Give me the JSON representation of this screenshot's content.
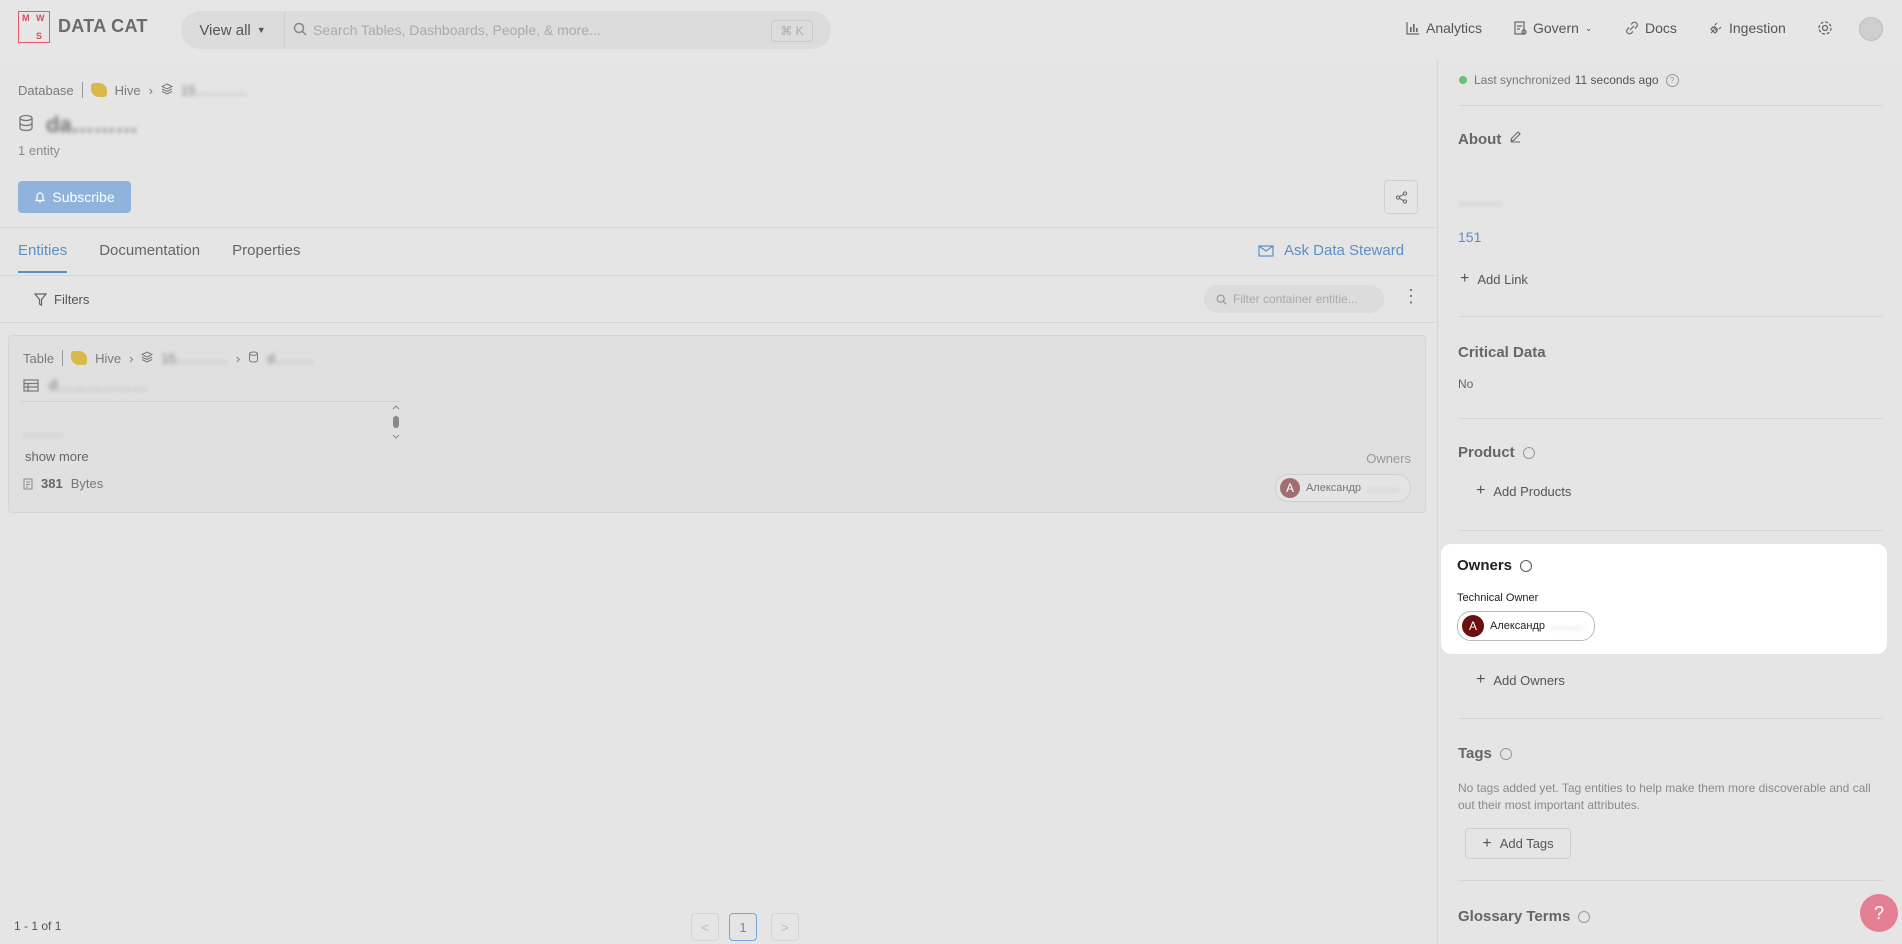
{
  "topbar": {
    "logo_letters": [
      "M",
      "W",
      "S"
    ],
    "brand": "DATA CAT",
    "view_all": "View all",
    "search_placeholder": "Search Tables, Dashboards, People, & more...",
    "shortcut": "⌘ K",
    "nav": {
      "analytics": "Analytics",
      "govern": "Govern",
      "docs": "Docs",
      "ingestion": "Ingestion"
    }
  },
  "breadcrumb": {
    "root": "Database",
    "service": "Hive",
    "schema": "15…………"
  },
  "page": {
    "title": "da………",
    "entity_count": "1 entity",
    "subscribe": "Subscribe"
  },
  "tabs": [
    "Entities",
    "Documentation",
    "Properties"
  ],
  "ask_data_steward": "Ask Data Steward",
  "filters_label": "Filters",
  "filter_placeholder": "Filter container entitie...",
  "entity_card": {
    "type": "Table",
    "service": "Hive",
    "schema": "15…………",
    "database": "d………",
    "name": "d………………",
    "description": "………",
    "show_more": "show more",
    "size_value": "381",
    "size_unit": "Bytes",
    "owners_label": "Owners",
    "owner_initial": "A",
    "owner_name": "Александр",
    "owner_surname": "………"
  },
  "pagination": {
    "range": "1 - 1 of 1",
    "prev": "<",
    "current": "1",
    "next": ">"
  },
  "side": {
    "sync_prefix": "Last synchronized",
    "sync_value": "11 seconds ago",
    "about": "About",
    "about_text": "………",
    "about_link": "151",
    "add_link": "Add Link",
    "critical_data": "Critical Data",
    "critical_value": "No",
    "product": "Product",
    "add_products": "Add Products",
    "owners": "Owners",
    "technical_owner": "Technical Owner",
    "owner_initial": "A",
    "owner_name": "Александр",
    "owner_surname": "………",
    "add_owners": "Add Owners",
    "tags": "Tags",
    "tags_empty": "No tags added yet. Tag entities to help make them more discoverable and call out their most important attributes.",
    "add_tags": "Add Tags",
    "glossary_terms": "Glossary Terms"
  },
  "help_button": "?",
  "colors": {
    "accent": "#5d8fc6",
    "subscribe_bg": "#8fb3da",
    "brand_red": "#d94a5c",
    "sync_dot": "#6fbf73",
    "owner_avatar": "#6a1010"
  }
}
